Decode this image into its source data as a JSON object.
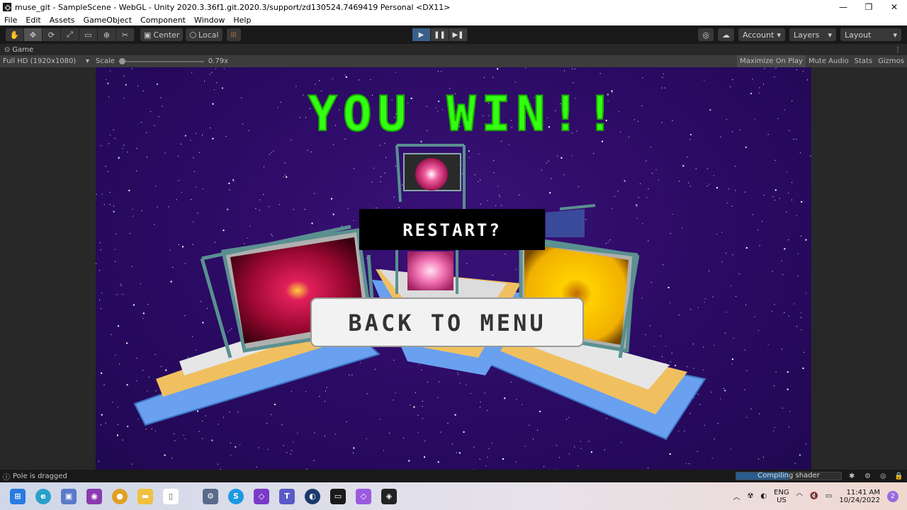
{
  "window": {
    "title": "muse_git - SampleScene - WebGL - Unity 2020.3.36f1.git.2020.3/support/zd130524.7469419 Personal <DX11>"
  },
  "menu": [
    "File",
    "Edit",
    "Assets",
    "GameObject",
    "Component",
    "Window",
    "Help"
  ],
  "toolbar": {
    "pivot_center": "Center",
    "pivot_local": "Local",
    "account": "Account",
    "layers": "Layers",
    "layout": "Layout"
  },
  "game_tab": {
    "label": "Game",
    "resolution": "Full HD (1920x1080)",
    "scale_label": "Scale",
    "scale_value": "0.79x",
    "maximize": "Maximize On Play",
    "mute": "Mute Audio",
    "stats": "Stats",
    "gizmos": "Gizmos"
  },
  "game": {
    "win_text": "YOU WIN!!",
    "restart": "RESTART?",
    "back_to_menu": "BACK TO MENU",
    "win_color": "#33ff11"
  },
  "status": {
    "message": "Pole is dragged",
    "progress_label": "Compiling shader",
    "progress": 0.5
  },
  "tray": {
    "lang1": "ENG",
    "lang2": "US",
    "time": "11:41 AM",
    "date": "10/24/2022",
    "notifications": "2"
  }
}
